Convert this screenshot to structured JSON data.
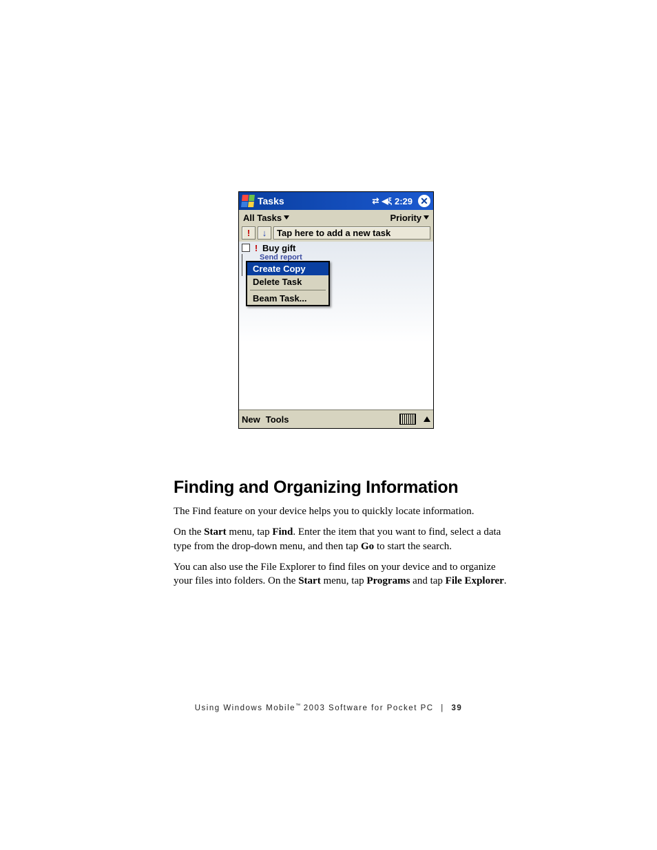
{
  "device": {
    "title": "Tasks",
    "time": "2:29",
    "filter_left": "All Tasks",
    "filter_right": "Priority",
    "add_placeholder": "Tap here to add a new task",
    "tasks": [
      {
        "label": "Buy gift",
        "priority": true
      },
      {
        "label": "Send report",
        "priority": false
      }
    ],
    "context_menu": {
      "items": [
        "Create Copy",
        "Delete Task",
        "Beam Task..."
      ],
      "selected": 0
    },
    "menubar": {
      "new": "New",
      "tools": "Tools"
    }
  },
  "doc": {
    "heading": "Finding and Organizing Information",
    "p1": "The Find feature on your device helps you to quickly locate information.",
    "p2a": "On the ",
    "p2b": "Start",
    "p2c": " menu, tap ",
    "p2d": "Find",
    "p2e": ". Enter the item that you want to find, select a data type from the drop-down menu, and then tap ",
    "p2f": "Go",
    "p2g": " to start the search.",
    "p3a": "You can also use the File Explorer to find files on your device and to organize your files into folders. On the ",
    "p3b": "Start",
    "p3c": " menu, tap ",
    "p3d": "Programs",
    "p3e": " and tap ",
    "p3f": "File Explorer",
    "p3g": "."
  },
  "footer": {
    "text_a": "Using Windows Mobile",
    "tm": "™",
    "text_b": " 2003 Software for Pocket PC",
    "page": "39"
  }
}
